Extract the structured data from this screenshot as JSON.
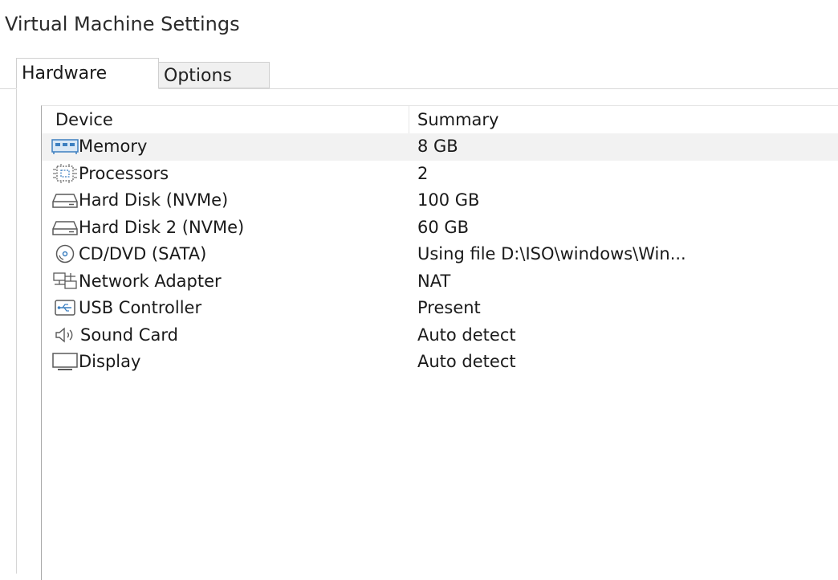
{
  "window": {
    "title": "Virtual Machine Settings"
  },
  "tabs": [
    {
      "label": "Hardware",
      "active": true
    },
    {
      "label": "Options",
      "active": false
    }
  ],
  "device_list": {
    "columns": {
      "device": "Device",
      "summary": "Summary"
    },
    "rows": [
      {
        "icon": "memory-icon",
        "device": "Memory",
        "summary": "8 GB",
        "selected": true
      },
      {
        "icon": "processor-icon",
        "device": "Processors",
        "summary": "2",
        "selected": false
      },
      {
        "icon": "hard-disk-icon",
        "device": "Hard Disk (NVMe)",
        "summary": "100 GB",
        "selected": false
      },
      {
        "icon": "hard-disk-icon",
        "device": "Hard Disk 2 (NVMe)",
        "summary": "60 GB",
        "selected": false
      },
      {
        "icon": "cd-dvd-icon",
        "device": "CD/DVD (SATA)",
        "summary": "Using file D:\\ISO\\windows\\Win...",
        "selected": false
      },
      {
        "icon": "network-adapter-icon",
        "device": "Network Adapter",
        "summary": "NAT",
        "selected": false
      },
      {
        "icon": "usb-controller-icon",
        "device": "USB Controller",
        "summary": "Present",
        "selected": false
      },
      {
        "icon": "sound-card-icon",
        "device": "Sound Card",
        "summary": "Auto detect",
        "selected": false
      },
      {
        "icon": "display-icon",
        "device": "Display",
        "summary": "Auto detect",
        "selected": false
      }
    ]
  },
  "colors": {
    "icon_blue": "#3c7fc0",
    "icon_gray": "#5a5a5a",
    "selected_row": "#f2f2f2"
  }
}
